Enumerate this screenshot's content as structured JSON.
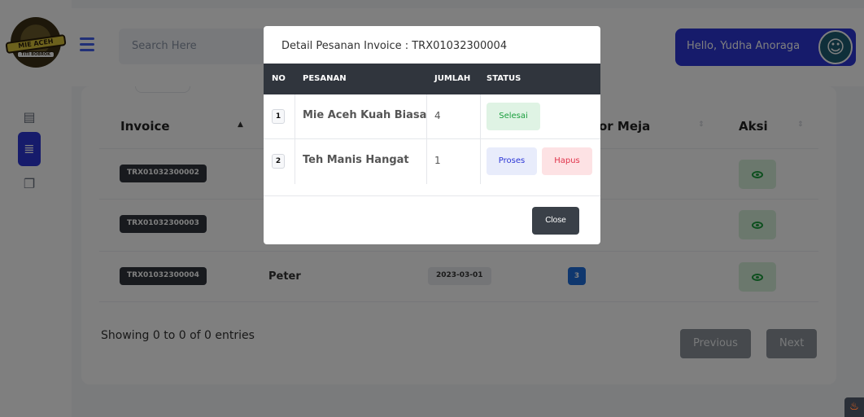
{
  "header": {
    "logo_text": "MIE ACEH",
    "logo_subtext": "TITI BOBROK",
    "search_placeholder": "Search Here",
    "greeting": "Hello, Yudha Anoraga"
  },
  "table": {
    "columns": {
      "invoice": "Invoice",
      "nomor_meja": "or Meja",
      "aksi": "Aksi"
    },
    "rows": [
      {
        "invoice": "TRX01032300002",
        "name": "",
        "date": "",
        "meja": ""
      },
      {
        "invoice": "TRX01032300003",
        "name": "",
        "date": "",
        "meja": ""
      },
      {
        "invoice": "TRX01032300004",
        "name": "Peter",
        "date": "2023-03-01",
        "meja": "3"
      }
    ],
    "showing": "Showing 0 to 0 of 0 entries",
    "previous": "Previous",
    "next": "Next"
  },
  "modal": {
    "title": "Detail Pesanan Invoice : TRX01032300004",
    "headers": {
      "no": "NO",
      "pesanan": "PESANAN",
      "jumlah": "JUMLAH",
      "status": "STATUS"
    },
    "items": [
      {
        "no": "1",
        "pesanan": "Mie Aceh Kuah Biasa",
        "jumlah": "4",
        "status": "Selesai"
      },
      {
        "no": "2",
        "pesanan": "Teh Manis Hangat",
        "jumlah": "1",
        "status": "Proses",
        "action": "Hapus"
      }
    ],
    "close": "Close"
  },
  "colors": {
    "primary": "#2c36d6",
    "dark": "#30353d",
    "success": "#1a9e3d",
    "danger": "#e0344b"
  }
}
